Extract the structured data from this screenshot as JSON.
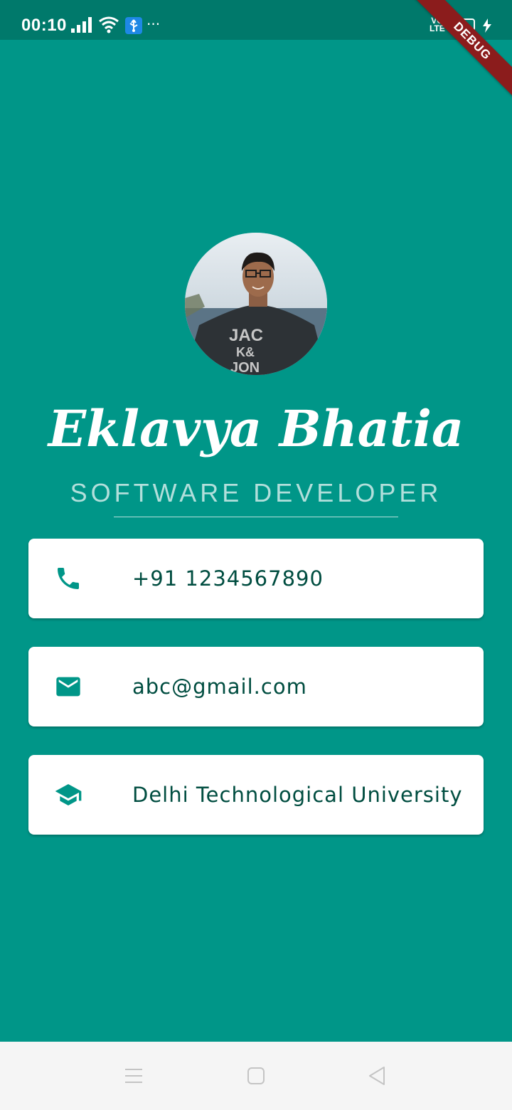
{
  "status_bar": {
    "time": "00:10",
    "network": "VO\nLTE",
    "battery_level": 0.35,
    "icons": [
      "signal-icon",
      "wifi-icon",
      "usb-icon",
      "more-icon",
      "volte-icon",
      "battery-icon",
      "charge-icon"
    ]
  },
  "debug_banner": "DEBUG",
  "profile": {
    "name": "Eklavya Bhatia",
    "title": "SOFTWARE DEVELOPER"
  },
  "contacts": [
    {
      "icon": "phone-icon",
      "text": "+91 1234567890"
    },
    {
      "icon": "email-icon",
      "text": "abc@gmail.com"
    },
    {
      "icon": "school-icon",
      "text": "Delhi Technological University"
    }
  ],
  "navigation": {
    "icons": [
      "menu-icon",
      "home-icon",
      "back-icon"
    ]
  },
  "colors": {
    "background": "#009688",
    "status_bar": "#00796b",
    "accent_text": "#b2dfdb",
    "card_text": "#004d40",
    "icon": "#009688",
    "banner": "#8b1c1c"
  }
}
